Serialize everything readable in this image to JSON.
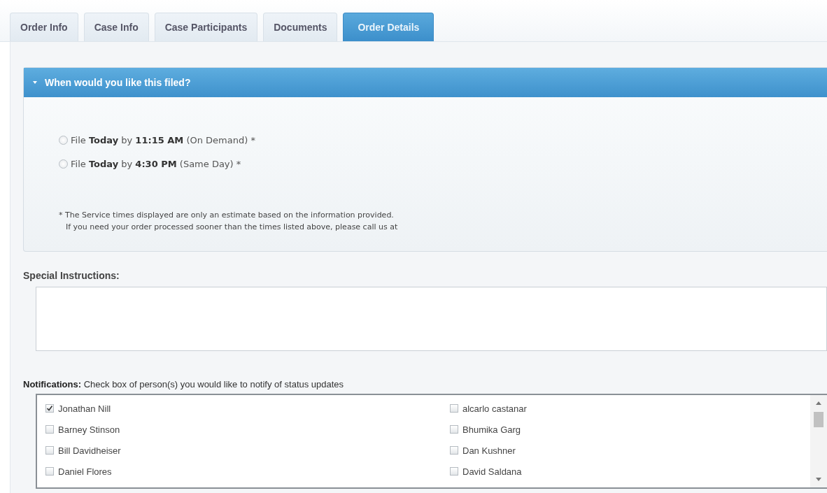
{
  "tabs": [
    {
      "label": "Order Info",
      "selected": false
    },
    {
      "label": "Case Info",
      "selected": false
    },
    {
      "label": "Case Participants",
      "selected": false
    },
    {
      "label": "Documents",
      "selected": false
    },
    {
      "label": "Order Details",
      "selected": true
    }
  ],
  "filing_section": {
    "title": "When would you like this filed?",
    "expanded": true,
    "options": [
      {
        "label": "File **Today** by **11:15 AM** (On Demand) *",
        "selected": false
      },
      {
        "label": "File **Today** by **4:30 PM** (Same Day) *",
        "selected": false
      }
    ],
    "notes": [
      "* The Service times displayed are only an estimate based on the information provided.",
      "If you need your order processed sooner than the times listed above, please call us at"
    ]
  },
  "special_instructions": {
    "label": "Special Instructions:"
  },
  "notifications": {
    "label": "**Notifications:** Check box of person(s) you would like to notify of status updates",
    "people": [
      {
        "name": "Jonathan Nill",
        "checked": true
      },
      {
        "name": "alcarlo castanar",
        "checked": false
      },
      {
        "name": "Barney Stinson",
        "checked": false
      },
      {
        "name": "Bhumika Garg",
        "checked": false
      },
      {
        "name": "Bill Davidheiser",
        "checked": false
      },
      {
        "name": "Dan Kushner",
        "checked": false
      },
      {
        "name": "Daniel Flores",
        "checked": false
      },
      {
        "name": "David Saldana",
        "checked": false
      }
    ]
  }
}
